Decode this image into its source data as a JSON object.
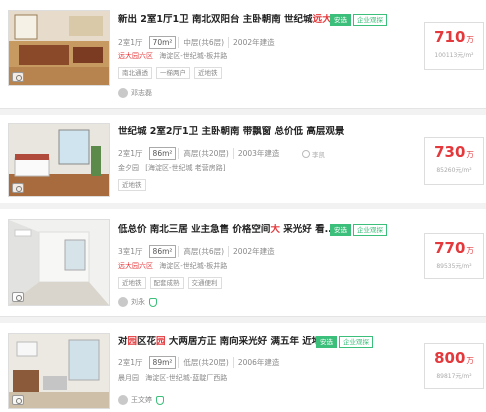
{
  "listings": [
    {
      "title_parts": [
        {
          "text": "新出 2室1厅1卫 南北双阳台 主卧朝南 世纪城",
          "hl": false
        },
        {
          "text": "远大",
          "hl": true
        }
      ],
      "badges": [
        {
          "label": "安选",
          "solid": true
        },
        {
          "label": "企业观探",
          "solid": false
        }
      ],
      "layout": "2室1厅",
      "area": "70m²",
      "floor": "中层(共6层)",
      "year": "2002年建造",
      "community": "远大园六区",
      "address": "海淀区-世纪城-板井路",
      "tags": [
        "南北通透",
        "一梯两户",
        "近地铁"
      ],
      "agent": "邓志磊",
      "price": "710",
      "price_unit": "万",
      "unit_price": "100113元/m²"
    },
    {
      "title_parts": [
        {
          "text": "世纪城 2室2厅1卫 主卧朝南 带飘窗 总价低 高层观景",
          "hl": false
        }
      ],
      "badges": [],
      "layout": "2室1厅",
      "area": "86m²",
      "floor": "高层(共20层)",
      "year": "2003年建造",
      "walker": "李凯",
      "community": "金夕园",
      "address": "[海淀区-世纪城 老营房路]",
      "tags": [
        "近地铁"
      ],
      "price": "730",
      "price_unit": "万",
      "unit_price": "85260元/m²"
    },
    {
      "title_parts": [
        {
          "text": "低总价 南北三居 业主急售 价格空间",
          "hl": false
        },
        {
          "text": "大",
          "hl": true
        },
        {
          "text": " 采光好 看...",
          "hl": false
        }
      ],
      "badges": [
        {
          "label": "安选",
          "solid": true
        },
        {
          "label": "企业观探",
          "solid": false
        }
      ],
      "layout": "3室1厅",
      "area": "86m²",
      "floor": "高层(共6层)",
      "year": "2002年建造",
      "community": "远大园六区",
      "address": "海淀区-世纪城-板井路",
      "tags": [
        "近地铁",
        "配套成熟",
        "交通便利"
      ],
      "agent": "刘永",
      "price": "770",
      "price_unit": "万",
      "unit_price": "89535元/m²"
    },
    {
      "title_parts": [
        {
          "text": "对",
          "hl": false
        },
        {
          "text": "园",
          "hl": true
        },
        {
          "text": "区花",
          "hl": false
        },
        {
          "text": "园",
          "hl": true
        },
        {
          "text": " 大两居方正 南向采光好 满五年 近地铁",
          "hl": false
        }
      ],
      "badges": [
        {
          "label": "安选",
          "solid": true
        },
        {
          "label": "企业观探",
          "solid": false
        }
      ],
      "layout": "2室1厅",
      "area": "89m²",
      "floor": "低层(共20层)",
      "year": "2006年建造",
      "community": "晨月园",
      "address": "海淀区-世纪城-蓝靛厂西路",
      "tags": [],
      "agent": "王文婷",
      "price": "800",
      "price_unit": "万",
      "unit_price": "89817元/m²"
    }
  ]
}
